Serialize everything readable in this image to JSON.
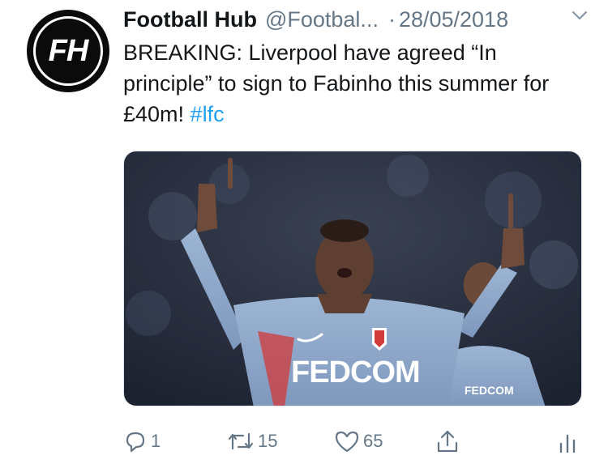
{
  "tweet": {
    "avatar_monogram": "FH",
    "display_name": "Football Hub",
    "handle": "@Footbal...",
    "separator": "·",
    "date": "28/05/2018",
    "text_main": "BREAKING: Liverpool have agreed “In principle” to sign to Fabinho this summer for £40m! ",
    "hashtag": "#lfc",
    "media": {
      "jersey_text": "FEDCOM"
    }
  },
  "actions": {
    "reply_count": "1",
    "retweet_count": "15",
    "like_count": "65"
  },
  "colors": {
    "text": "#14171a",
    "secondary": "#657786",
    "link": "#1da1f2",
    "jersey": "#8fa8c9"
  },
  "icons": {
    "caret": "chevron-down-icon",
    "reply": "reply-icon",
    "retweet": "retweet-icon",
    "like": "heart-icon",
    "share": "share-icon",
    "analytics": "analytics-icon"
  }
}
